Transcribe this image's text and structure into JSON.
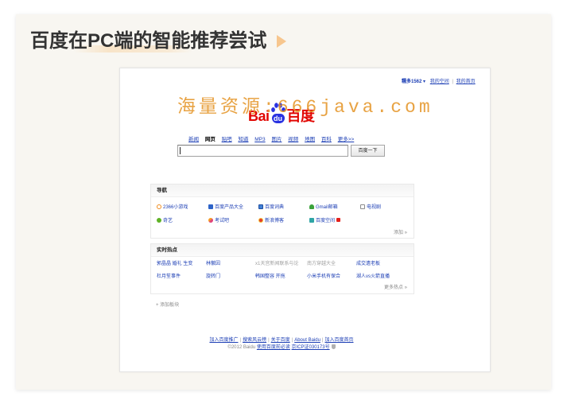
{
  "slide": {
    "title": "百度在PC端的智能推荐尝试",
    "title_color": "#333333",
    "accent_color": "#f7c68e",
    "background_color": "#f8f6f1",
    "arrow_icon": "play-triangle-icon"
  },
  "watermark": {
    "text": "海量资源:666java.com",
    "color": "#e5962a"
  },
  "baidu_page": {
    "link_color": "#1d3fb5",
    "account": {
      "username": "糯多1562",
      "dropdown_symbol": "▾",
      "links": [
        "我的空间",
        "我的首页"
      ],
      "separator": "|"
    },
    "logo": {
      "text_left": "Bai",
      "text_paw": "du",
      "text_right": "百度",
      "icon": "paw-print-icon",
      "red": "#e10602",
      "blue": "#2932e1"
    },
    "nav_tabs": [
      {
        "label": "新闻"
      },
      {
        "label": "网页",
        "selected": true
      },
      {
        "label": "贴吧"
      },
      {
        "label": "知道"
      },
      {
        "label": "MP3"
      },
      {
        "label": "图片"
      },
      {
        "label": "视频"
      },
      {
        "label": "地图"
      },
      {
        "label": "百科"
      },
      {
        "label": "更多>>"
      }
    ],
    "search": {
      "value": "",
      "button_label": "百度一下"
    },
    "nav_panel": {
      "title": "导航",
      "rows": [
        [
          {
            "label": "2366小游戏",
            "icon": "game-icon"
          },
          {
            "label": "百度产品大全",
            "icon": "baidu-products-icon"
          },
          {
            "label": "百度词典",
            "icon": "dictionary-icon"
          },
          {
            "label": "Gmail邮箱",
            "icon": "mail-icon"
          },
          {
            "label": "电视剧",
            "icon": "tv-icon"
          }
        ],
        [
          {
            "label": "奇艺",
            "icon": "qiyi-icon"
          },
          {
            "label": "考试吧",
            "icon": "exam-icon"
          },
          {
            "label": "新浪博客",
            "icon": "sina-blog-icon"
          },
          {
            "label": "百度空间",
            "icon": "baidu-space-icon",
            "badge_icon": "new-badge-icon"
          }
        ]
      ],
      "add_label": "添加 »"
    },
    "hot_panel": {
      "title": "实时热点",
      "rows": [
        [
          {
            "label": "郭晶晶 婚礼 生变"
          },
          {
            "label": "林徽因"
          },
          {
            "label": "x1天宫新闻联系与论",
            "muted": true
          },
          {
            "label": "南方穿越大全",
            "muted": true
          },
          {
            "label": "成交遗老板"
          }
        ],
        [
          {
            "label": "杜月笙事件"
          },
          {
            "label": "旋转门"
          },
          {
            "label": "韩国整容 开拖"
          },
          {
            "label": "小米手机有保合"
          },
          {
            "label": "湖人vs火箭直播"
          }
        ]
      ],
      "more_label": "更多热点 »"
    },
    "add_module_label": "+ 添加板块",
    "footer": {
      "links": [
        "加入百度推广",
        "搜索风云榜",
        "关于百度",
        "About Baidu",
        "加入百度首页"
      ],
      "separator": "|",
      "copyright": "©2012 Baidu",
      "terms_link": "使用百度前必读",
      "icp": "京ICP证030173号",
      "icp_icon": "police-badge-icon"
    }
  }
}
